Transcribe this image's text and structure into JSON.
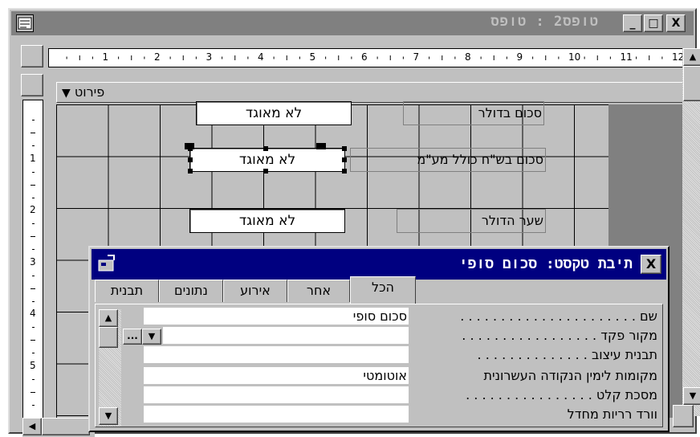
{
  "window": {
    "title": "טופס2 : טופס",
    "controls": {
      "minimize": "_",
      "maximize": "□",
      "close": "X"
    }
  },
  "ruler": {
    "horizontal_numbers": [
      "1",
      "2",
      "3",
      "4",
      "5",
      "6",
      "7",
      "8",
      "9",
      "10",
      "11",
      "12"
    ],
    "vertical_numbers": [
      "1",
      "2",
      "3",
      "4",
      "5"
    ]
  },
  "section_header": {
    "label": "פירוט"
  },
  "form_controls": [
    {
      "textbox": "לא מאוגד",
      "label": "סכום בדולר"
    },
    {
      "textbox": "לא מאוגד",
      "label": "סכום  בש\"ח כולל מע\"מ"
    },
    {
      "textbox": "לא מאוגד",
      "label": "שער הדולר"
    }
  ],
  "properties_dialog": {
    "title": "תיבת טקסט: סכום סופי",
    "close": "X",
    "tabs": [
      "הכל",
      "אחר",
      "אירוע",
      "נתונים",
      "תבנית"
    ],
    "active_tab": "הכל",
    "properties": [
      {
        "name": "שם . . . . . . . . . . . . . . . . . . . . . .",
        "value": "סכום סופי"
      },
      {
        "name": "מקור פקד . . . . . . . . . . . . . . . . .",
        "value": ""
      },
      {
        "name": "תבנית עיצוב . . . . . . . . . . . . . .",
        "value": ""
      },
      {
        "name": "מקומות לימין הנקודה העשרונית",
        "value": "אוטומטי"
      },
      {
        "name": "מסכת קלט . . . . . . . . . . . . . . . .",
        "value": ""
      },
      {
        "name": "וורד רריות מחדל",
        "value": ""
      }
    ],
    "builder_button": "...",
    "dropdown_button": "▼"
  },
  "colors": {
    "titlebar_inactive": "#808080",
    "dialog_title_active": "#000080",
    "face": "#c0c0c0"
  }
}
